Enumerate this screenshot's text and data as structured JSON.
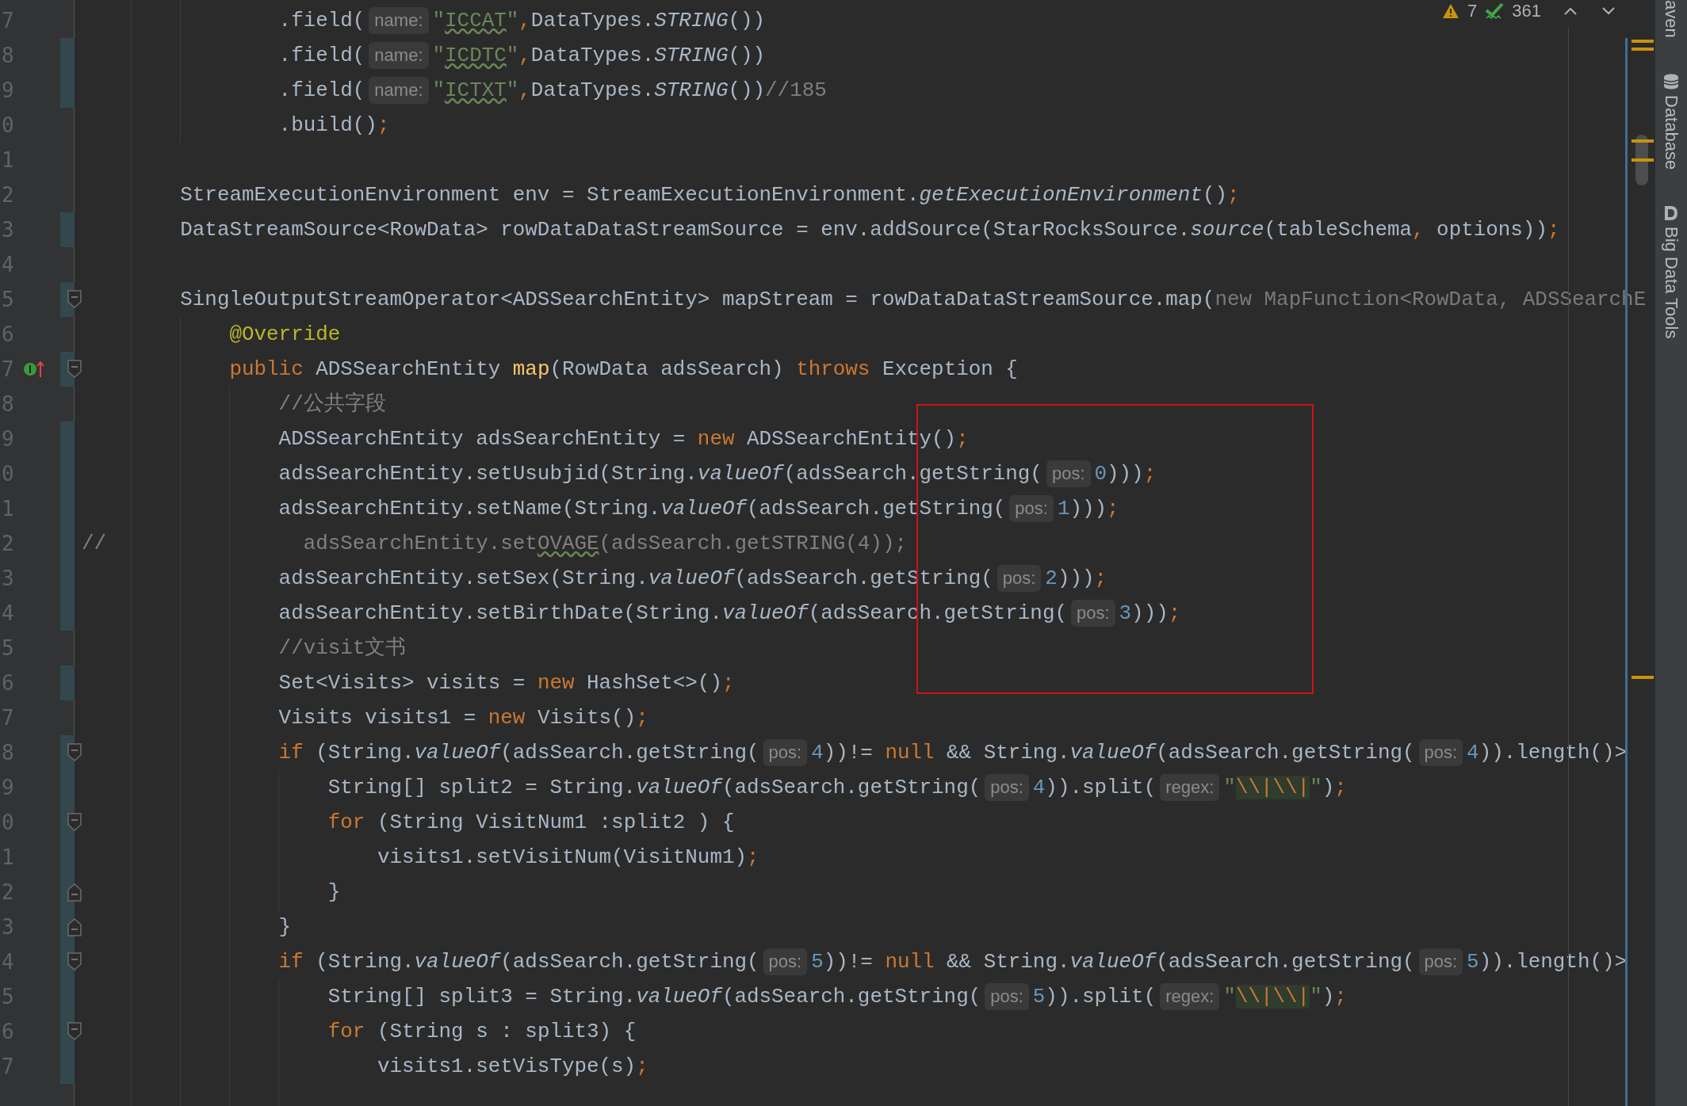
{
  "editor": {
    "lines": [
      {
        "number": "7",
        "changed": false,
        "tokens": [
          {
            "kind": "plain",
            "text": "                .field("
          },
          {
            "kind": "hint",
            "text": "name:"
          },
          {
            "kind": "string",
            "text": "\""
          },
          {
            "kind": "typo",
            "text": "ICCAT"
          },
          {
            "kind": "string",
            "text": "\""
          },
          {
            "kind": "keyword",
            "text": ","
          },
          {
            "kind": "plain",
            "text": "DataTypes."
          },
          {
            "kind": "static",
            "text": "STRING"
          },
          {
            "kind": "plain",
            "text": "())"
          }
        ]
      },
      {
        "number": "8",
        "changed": true,
        "tokens": [
          {
            "kind": "plain",
            "text": "                .field("
          },
          {
            "kind": "hint",
            "text": "name:"
          },
          {
            "kind": "string",
            "text": "\""
          },
          {
            "kind": "typo",
            "text": "ICDTC"
          },
          {
            "kind": "string",
            "text": "\""
          },
          {
            "kind": "keyword",
            "text": ","
          },
          {
            "kind": "plain",
            "text": "DataTypes."
          },
          {
            "kind": "static",
            "text": "STRING"
          },
          {
            "kind": "plain",
            "text": "())"
          }
        ]
      },
      {
        "number": "9",
        "changed": true,
        "tokens": [
          {
            "kind": "plain",
            "text": "                .field("
          },
          {
            "kind": "hint",
            "text": "name:"
          },
          {
            "kind": "string",
            "text": "\""
          },
          {
            "kind": "typo",
            "text": "ICTXT"
          },
          {
            "kind": "string",
            "text": "\""
          },
          {
            "kind": "keyword",
            "text": ","
          },
          {
            "kind": "plain",
            "text": "DataTypes."
          },
          {
            "kind": "static",
            "text": "STRING"
          },
          {
            "kind": "plain",
            "text": "())"
          },
          {
            "kind": "comment",
            "text": "//185"
          }
        ]
      },
      {
        "number": "0",
        "changed": false,
        "tokens": [
          {
            "kind": "plain",
            "text": "                .build()"
          },
          {
            "kind": "keyword",
            "text": ";"
          }
        ]
      },
      {
        "number": "1",
        "changed": false
      },
      {
        "number": "2",
        "changed": false,
        "tokens": [
          {
            "kind": "plain",
            "text": "        StreamExecutionEnvironment env = StreamExecutionEnvironment."
          },
          {
            "kind": "static",
            "text": "getExecutionEnvironment"
          },
          {
            "kind": "plain",
            "text": "()"
          },
          {
            "kind": "keyword",
            "text": ";"
          }
        ]
      },
      {
        "number": "3",
        "changed": true,
        "tokens": [
          {
            "kind": "plain",
            "text": "        DataStreamSource<RowData> rowDataDataStreamSource = env.addSource(StarRocksSource."
          },
          {
            "kind": "static",
            "text": "source"
          },
          {
            "kind": "plain",
            "text": "(tableSchema"
          },
          {
            "kind": "keyword",
            "text": ","
          },
          {
            "kind": "plain",
            "text": " options))"
          },
          {
            "kind": "keyword",
            "text": ";"
          }
        ]
      },
      {
        "number": "4",
        "changed": false
      },
      {
        "number": "5",
        "changed": true,
        "markers": [
          {
            "kind": "foldstart"
          }
        ],
        "tokens": [
          {
            "kind": "plain",
            "text": "        SingleOutputStreamOperator<ADSSearchEntity> mapStream = rowDataDataStreamSource.map("
          },
          {
            "kind": "dim",
            "text": "new MapFunction<RowData, ADSSearchE"
          }
        ]
      },
      {
        "number": "6",
        "changed": false,
        "tokens": [
          {
            "kind": "annotation",
            "text": "            @Override"
          }
        ]
      },
      {
        "number": "7",
        "changed": true,
        "markers": [
          {
            "kind": "implements"
          },
          {
            "kind": "foldstart"
          }
        ],
        "tokens": [
          {
            "kind": "keyword",
            "text": "            public"
          },
          {
            "kind": "plain",
            "text": " ADSSearchEntity "
          },
          {
            "kind": "method",
            "text": "map"
          },
          {
            "kind": "plain",
            "text": "(RowData adsSearch) "
          },
          {
            "kind": "keyword",
            "text": "throws"
          },
          {
            "kind": "plain",
            "text": " Exception {"
          }
        ]
      },
      {
        "number": "8",
        "changed": false,
        "tokens": [
          {
            "kind": "comment",
            "text": "                //公共字段"
          }
        ]
      },
      {
        "number": "9",
        "changed": true,
        "tokens": [
          {
            "kind": "plain",
            "text": "                ADSSearchEntity adsSearchEntity = "
          },
          {
            "kind": "keyword",
            "text": "new"
          },
          {
            "kind": "plain",
            "text": " ADSSearchEntity()"
          },
          {
            "kind": "keyword",
            "text": ";"
          }
        ]
      },
      {
        "number": "0",
        "changed": true,
        "tokens": [
          {
            "kind": "plain",
            "text": "                adsSearchEntity.setUsubjid(String."
          },
          {
            "kind": "static",
            "text": "valueOf"
          },
          {
            "kind": "plain",
            "text": "(adsSearch.getString("
          },
          {
            "kind": "hint",
            "text": "pos:"
          },
          {
            "kind": "number",
            "text": "0"
          },
          {
            "kind": "plain",
            "text": ")))"
          },
          {
            "kind": "keyword",
            "text": ";"
          }
        ]
      },
      {
        "number": "1",
        "changed": true,
        "tokens": [
          {
            "kind": "plain",
            "text": "                adsSearchEntity.setName(String."
          },
          {
            "kind": "static",
            "text": "valueOf"
          },
          {
            "kind": "plain",
            "text": "(adsSearch.getString("
          },
          {
            "kind": "hint",
            "text": "pos:"
          },
          {
            "kind": "number",
            "text": "1"
          },
          {
            "kind": "plain",
            "text": ")))"
          },
          {
            "kind": "keyword",
            "text": ";"
          }
        ]
      },
      {
        "number": "2",
        "changed": true,
        "tokens": [
          {
            "kind": "comment",
            "text": "//                adsSearchEntity.set"
          },
          {
            "kind": "commenttypo",
            "text": "OVAGE"
          },
          {
            "kind": "comment",
            "text": "(adsSearch.getSTRING(4));"
          }
        ]
      },
      {
        "number": "3",
        "changed": true,
        "tokens": [
          {
            "kind": "plain",
            "text": "                adsSearchEntity.setSex(String."
          },
          {
            "kind": "static",
            "text": "valueOf"
          },
          {
            "kind": "plain",
            "text": "(adsSearch.getString("
          },
          {
            "kind": "hint",
            "text": "pos:"
          },
          {
            "kind": "number",
            "text": "2"
          },
          {
            "kind": "plain",
            "text": ")))"
          },
          {
            "kind": "keyword",
            "text": ";"
          }
        ]
      },
      {
        "number": "4",
        "changed": true,
        "tokens": [
          {
            "kind": "plain",
            "text": "                adsSearchEntity.setBirthDate(String."
          },
          {
            "kind": "static",
            "text": "valueOf"
          },
          {
            "kind": "plain",
            "text": "(adsSearch.getString("
          },
          {
            "kind": "hint",
            "text": "pos:"
          },
          {
            "kind": "number",
            "text": "3"
          },
          {
            "kind": "plain",
            "text": ")))"
          },
          {
            "kind": "keyword",
            "text": ";"
          }
        ]
      },
      {
        "number": "5",
        "changed": false,
        "tokens": [
          {
            "kind": "comment",
            "text": "                //visit文书"
          }
        ]
      },
      {
        "number": "6",
        "changed": true,
        "tokens": [
          {
            "kind": "plain",
            "text": "                Set<Visits> visits = "
          },
          {
            "kind": "keyword",
            "text": "new"
          },
          {
            "kind": "plain",
            "text": " HashSet<>()"
          },
          {
            "kind": "keyword",
            "text": ";"
          }
        ]
      },
      {
        "number": "7",
        "changed": false,
        "tokens": [
          {
            "kind": "plain",
            "text": "                Visits visits1 = "
          },
          {
            "kind": "keyword",
            "text": "new"
          },
          {
            "kind": "plain",
            "text": " Visits()"
          },
          {
            "kind": "keyword",
            "text": ";"
          }
        ]
      },
      {
        "number": "8",
        "changed": true,
        "markers": [
          {
            "kind": "foldstart"
          }
        ],
        "tokens": [
          {
            "kind": "keyword",
            "text": "                if"
          },
          {
            "kind": "plain",
            "text": " (String."
          },
          {
            "kind": "static",
            "text": "valueOf"
          },
          {
            "kind": "plain",
            "text": "(adsSearch.getString("
          },
          {
            "kind": "hint",
            "text": "pos:"
          },
          {
            "kind": "number",
            "text": "4"
          },
          {
            "kind": "plain",
            "text": "))!= "
          },
          {
            "kind": "keyword",
            "text": "null"
          },
          {
            "kind": "plain",
            "text": " && String."
          },
          {
            "kind": "static",
            "text": "valueOf"
          },
          {
            "kind": "plain",
            "text": "(adsSearch.getString("
          },
          {
            "kind": "hint",
            "text": "pos:"
          },
          {
            "kind": "number",
            "text": "4"
          },
          {
            "kind": "plain",
            "text": ")).length()>"
          }
        ]
      },
      {
        "number": "9",
        "changed": true,
        "tokens": [
          {
            "kind": "plain",
            "text": "                    String[] split2 = String."
          },
          {
            "kind": "static",
            "text": "valueOf"
          },
          {
            "kind": "plain",
            "text": "(adsSearch.getString("
          },
          {
            "kind": "hint",
            "text": "pos:"
          },
          {
            "kind": "number",
            "text": "4"
          },
          {
            "kind": "plain",
            "text": ")).split("
          },
          {
            "kind": "hint",
            "text": "regex:"
          },
          {
            "kind": "string",
            "text": "\""
          },
          {
            "kind": "regex",
            "text": "\\\\|\\\\|"
          },
          {
            "kind": "string",
            "text": "\""
          },
          {
            "kind": "plain",
            "text": ")"
          },
          {
            "kind": "keyword",
            "text": ";"
          }
        ]
      },
      {
        "number": "0",
        "changed": true,
        "markers": [
          {
            "kind": "foldstart"
          }
        ],
        "tokens": [
          {
            "kind": "keyword",
            "text": "                    for"
          },
          {
            "kind": "plain",
            "text": " (String VisitNum1 :split2 ) {"
          }
        ]
      },
      {
        "number": "1",
        "changed": true,
        "tokens": [
          {
            "kind": "plain",
            "text": "                        visits1.setVisitNum(VisitNum1)"
          },
          {
            "kind": "keyword",
            "text": ";"
          }
        ]
      },
      {
        "number": "2",
        "changed": true,
        "markers": [
          {
            "kind": "foldend"
          }
        ],
        "tokens": [
          {
            "kind": "plain",
            "text": "                    }"
          }
        ]
      },
      {
        "number": "3",
        "changed": true,
        "markers": [
          {
            "kind": "foldend"
          }
        ],
        "tokens": [
          {
            "kind": "plain",
            "text": "                }"
          }
        ]
      },
      {
        "number": "4",
        "changed": true,
        "markers": [
          {
            "kind": "foldstart"
          }
        ],
        "tokens": [
          {
            "kind": "keyword",
            "text": "                if"
          },
          {
            "kind": "plain",
            "text": " (String."
          },
          {
            "kind": "static",
            "text": "valueOf"
          },
          {
            "kind": "plain",
            "text": "(adsSearch.getString("
          },
          {
            "kind": "hint",
            "text": "pos:"
          },
          {
            "kind": "number",
            "text": "5"
          },
          {
            "kind": "plain",
            "text": "))!= "
          },
          {
            "kind": "keyword",
            "text": "null"
          },
          {
            "kind": "plain",
            "text": " && String."
          },
          {
            "kind": "static",
            "text": "valueOf"
          },
          {
            "kind": "plain",
            "text": "(adsSearch.getString("
          },
          {
            "kind": "hint",
            "text": "pos:"
          },
          {
            "kind": "number",
            "text": "5"
          },
          {
            "kind": "plain",
            "text": ")).length()>"
          }
        ]
      },
      {
        "number": "5",
        "changed": true,
        "tokens": [
          {
            "kind": "plain",
            "text": "                    String[] split3 = String."
          },
          {
            "kind": "static",
            "text": "valueOf"
          },
          {
            "kind": "plain",
            "text": "(adsSearch.getString("
          },
          {
            "kind": "hint",
            "text": "pos:"
          },
          {
            "kind": "number",
            "text": "5"
          },
          {
            "kind": "plain",
            "text": ")).split("
          },
          {
            "kind": "hint",
            "text": "regex:"
          },
          {
            "kind": "string",
            "text": "\""
          },
          {
            "kind": "regex",
            "text": "\\\\|\\\\|"
          },
          {
            "kind": "string",
            "text": "\""
          },
          {
            "kind": "plain",
            "text": ")"
          },
          {
            "kind": "keyword",
            "text": ";"
          }
        ]
      },
      {
        "number": "6",
        "changed": true,
        "markers": [
          {
            "kind": "foldstart"
          }
        ],
        "tokens": [
          {
            "kind": "keyword",
            "text": "                    for"
          },
          {
            "kind": "plain",
            "text": " (String s : split3) {"
          }
        ]
      },
      {
        "number": "7",
        "changed": true,
        "tokens": [
          {
            "kind": "plain",
            "text": "                        visits1.setVisType(s)"
          },
          {
            "kind": "keyword",
            "text": ";"
          }
        ]
      }
    ]
  },
  "inspections": {
    "warnings": "7",
    "passed": "361"
  },
  "tool_strip": [
    {
      "kind": "maven",
      "label": "aven"
    },
    {
      "kind": "database",
      "label": "Database"
    },
    {
      "kind": "bigdata",
      "label": "Big Data Tools"
    }
  ]
}
